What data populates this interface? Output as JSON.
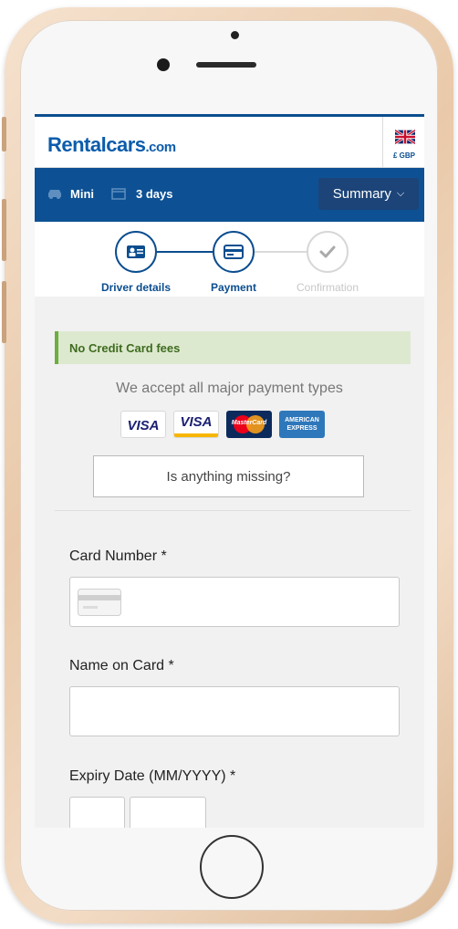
{
  "app": {
    "logo_main": "Rentalcars",
    "logo_suffix": ".com",
    "currency": "£ GBP"
  },
  "trip": {
    "car_class": "Mini",
    "duration": "3 days",
    "summary_label": "Summary",
    "summary_caret": "⌵"
  },
  "steps": [
    {
      "label": "Driver details",
      "state": "complete",
      "icon": "id-card-icon"
    },
    {
      "label": "Payment",
      "state": "active",
      "icon": "credit-card-icon"
    },
    {
      "label": "Confirmation",
      "state": "pending",
      "icon": "check-icon"
    }
  ],
  "payment": {
    "fees_notice": "No Credit Card fees",
    "accept_text": "We accept all major payment types",
    "card_logos": [
      {
        "name": "visa-logo",
        "text": "VISA"
      },
      {
        "name": "visa-debit-logo",
        "text": "VISA"
      },
      {
        "name": "mastercard-logo",
        "text": "MasterCard"
      },
      {
        "name": "amex-logo",
        "text": "AMERICAN EXPRESS"
      }
    ],
    "missing_button": "Is anything missing?"
  },
  "form": {
    "card_number_label": "Card Number *",
    "card_number_value": "",
    "name_label": "Name on Card *",
    "name_value": "",
    "expiry_label": "Expiry Date (MM/YYYY) *",
    "expiry_month": "",
    "expiry_year": ""
  },
  "colors": {
    "brand_blue": "#0d5194",
    "summary_button": "#1c4478",
    "notice_bg": "#dde9cf",
    "notice_accent": "#6cae3f"
  }
}
